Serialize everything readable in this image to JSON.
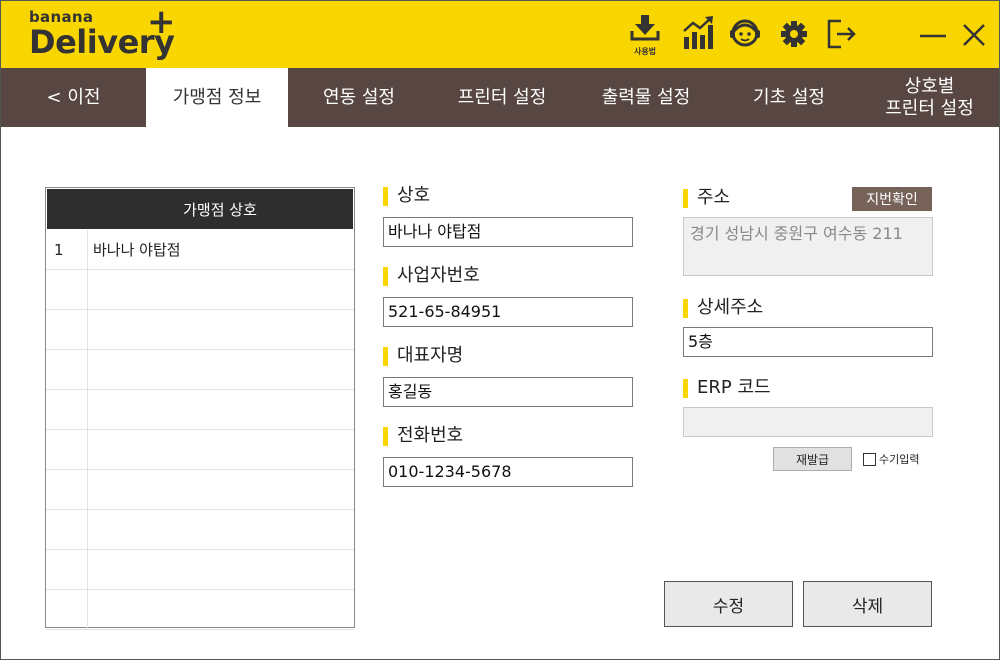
{
  "header": {
    "logo_small": "banana",
    "logo_big": "Delivery",
    "logo_plus": "+",
    "guide_label": "사용법",
    "icons": [
      "download-icon",
      "stats-chart-icon",
      "support-agent-icon",
      "gear-icon",
      "logout-icon",
      "minimize-icon",
      "close-icon"
    ]
  },
  "nav": {
    "tabs": [
      {
        "label": "< 이전"
      },
      {
        "label": "가맹점 정보"
      },
      {
        "label": "연동 설정"
      },
      {
        "label": "프린터 설정"
      },
      {
        "label": "출력물 설정"
      },
      {
        "label": "기초 설정"
      },
      {
        "label": "상호별\n프린터 설정"
      }
    ]
  },
  "list": {
    "header": "가맹점 상호",
    "rows": [
      {
        "num": "1",
        "name": "바나나 야탑점"
      },
      {
        "num": "",
        "name": ""
      },
      {
        "num": "",
        "name": ""
      },
      {
        "num": "",
        "name": ""
      },
      {
        "num": "",
        "name": ""
      },
      {
        "num": "",
        "name": ""
      },
      {
        "num": "",
        "name": ""
      },
      {
        "num": "",
        "name": ""
      },
      {
        "num": "",
        "name": ""
      },
      {
        "num": "",
        "name": ""
      }
    ]
  },
  "form": {
    "store_name_label": "상호",
    "store_name_value": "바나나 야탑점",
    "biz_no_label": "사업자번호",
    "biz_no_value": "521-65-84951",
    "owner_label": "대표자명",
    "owner_value": "홍길동",
    "phone_label": "전화번호",
    "phone_value": "010-1234-5678",
    "address_label": "주소",
    "address_value": "경기 성남시 중원구 여수동 211",
    "jibun_button": "지번확인",
    "detail_address_label": "상세주소",
    "detail_address_value": "5층",
    "erp_label": "ERP 코드",
    "erp_value": "",
    "reissue_button": "재발급",
    "manual_input_label": "수기입력"
  },
  "actions": {
    "edit_button": "수정",
    "delete_button": "삭제"
  },
  "colors": {
    "header_yellow": "#fad600",
    "nav_brown": "#574641",
    "jibun_brown": "#766259",
    "list_header_dark": "#2e2e2e"
  }
}
